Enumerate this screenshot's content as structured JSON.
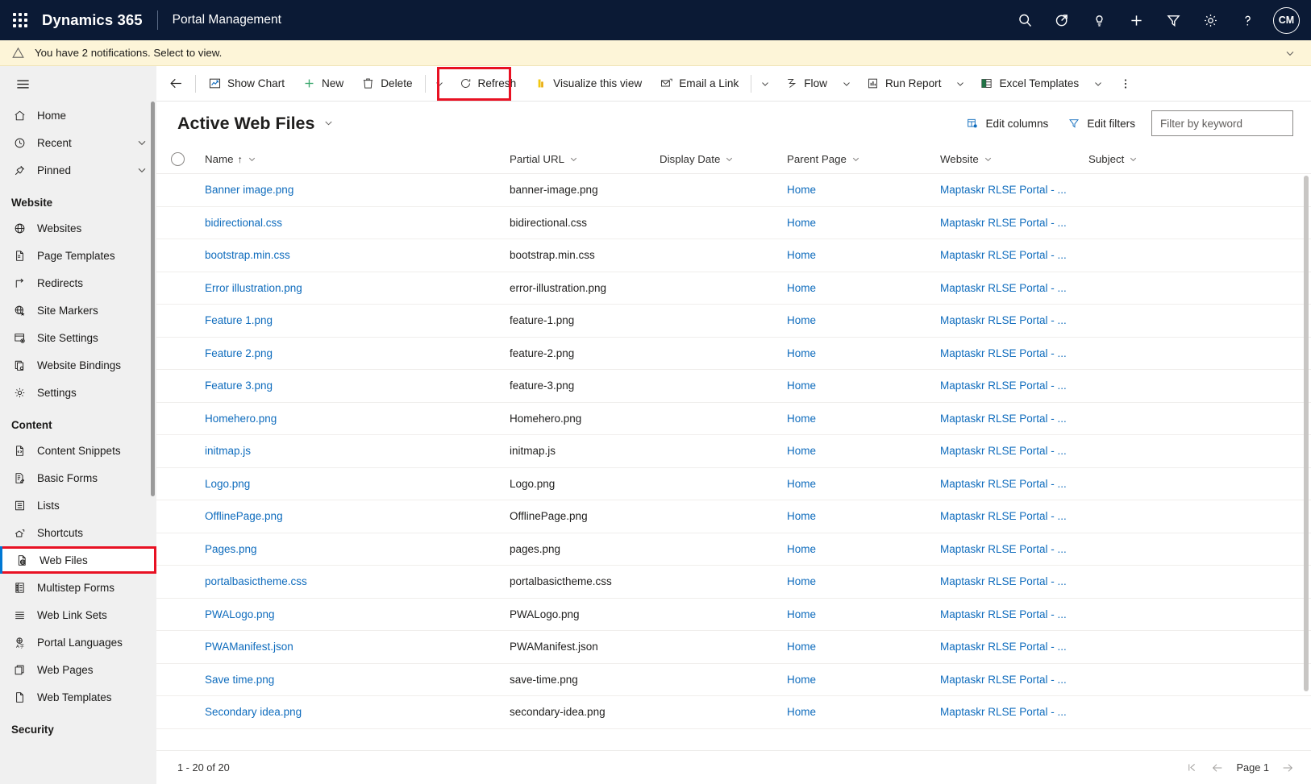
{
  "topbar": {
    "waffle_label": "App launcher",
    "brand": "Dynamics 365",
    "app_name": "Portal Management",
    "icons": [
      {
        "name": "search-icon",
        "label": "Search"
      },
      {
        "name": "diagnostics-icon",
        "label": "Diagnostics"
      },
      {
        "name": "lightbulb-icon",
        "label": "Tips"
      },
      {
        "name": "quick-create-icon",
        "label": "Quick create"
      },
      {
        "name": "filter-icon",
        "label": "Filter"
      },
      {
        "name": "gear-icon",
        "label": "Settings"
      },
      {
        "name": "help-icon",
        "label": "Help"
      }
    ],
    "avatar_initials": "CM"
  },
  "notification": {
    "text": "You have 2 notifications. Select to view.",
    "icon": "warning-icon",
    "collapse_icon": "chevron-down-icon",
    "bg_color": "#fdf5d8"
  },
  "sidebar": {
    "hamburger_label": "Expand/collapse navigation",
    "items": [
      {
        "label": "Home",
        "icon": "home-icon",
        "type": "item",
        "chevron": false
      },
      {
        "label": "Recent",
        "icon": "clock-icon",
        "type": "item",
        "chevron": true
      },
      {
        "label": "Pinned",
        "icon": "pin-icon",
        "type": "item",
        "chevron": true
      },
      {
        "label": "Website",
        "icon": "",
        "type": "group",
        "chevron": false
      },
      {
        "label": "Websites",
        "icon": "globe-icon",
        "type": "item",
        "chevron": false
      },
      {
        "label": "Page Templates",
        "icon": "page-template-icon",
        "type": "item",
        "chevron": false
      },
      {
        "label": "Redirects",
        "icon": "redirect-icon",
        "type": "item",
        "chevron": false
      },
      {
        "label": "Site Markers",
        "icon": "site-marker-icon",
        "type": "item",
        "chevron": false
      },
      {
        "label": "Site Settings",
        "icon": "site-settings-icon",
        "type": "item",
        "chevron": false
      },
      {
        "label": "Website Bindings",
        "icon": "website-binding-icon",
        "type": "item",
        "chevron": false
      },
      {
        "label": "Settings",
        "icon": "gear-icon",
        "type": "item",
        "chevron": false
      },
      {
        "label": "Content",
        "icon": "",
        "type": "group",
        "chevron": false
      },
      {
        "label": "Content Snippets",
        "icon": "code-snippet-icon",
        "type": "item",
        "chevron": false
      },
      {
        "label": "Basic Forms",
        "icon": "basic-form-icon",
        "type": "item",
        "chevron": false
      },
      {
        "label": "Lists",
        "icon": "list-icon",
        "type": "item",
        "chevron": false
      },
      {
        "label": "Shortcuts",
        "icon": "shortcut-icon",
        "type": "item",
        "chevron": false
      },
      {
        "label": "Web Files",
        "icon": "web-file-icon",
        "type": "item",
        "chevron": false,
        "selected": true
      },
      {
        "label": "Multistep Forms",
        "icon": "multistep-form-icon",
        "type": "item",
        "chevron": false
      },
      {
        "label": "Web Link Sets",
        "icon": "web-link-set-icon",
        "type": "item",
        "chevron": false
      },
      {
        "label": "Portal Languages",
        "icon": "language-icon",
        "type": "item",
        "chevron": false
      },
      {
        "label": "Web Pages",
        "icon": "web-page-icon",
        "type": "item",
        "chevron": false
      },
      {
        "label": "Web Templates",
        "icon": "web-template-icon",
        "type": "item",
        "chevron": false
      },
      {
        "label": "Security",
        "icon": "",
        "type": "group",
        "chevron": false
      }
    ],
    "selection_highlight_color": "#e81123"
  },
  "commandbar": {
    "back_label": "Back",
    "buttons": [
      {
        "label": "Show Chart",
        "icon": "chart-icon",
        "caret": false
      },
      {
        "label": "New",
        "icon": "plus-icon",
        "caret": false,
        "highlighted": true
      },
      {
        "label": "Delete",
        "icon": "trash-icon",
        "caret": true
      },
      {
        "label": "Refresh",
        "icon": "refresh-icon",
        "caret": false
      },
      {
        "label": "Visualize this view",
        "icon": "visualize-icon",
        "caret": false
      },
      {
        "label": "Email a Link",
        "icon": "email-icon",
        "caret": true
      },
      {
        "label": "Flow",
        "icon": "flow-icon",
        "caret": true
      },
      {
        "label": "Run Report",
        "icon": "report-icon",
        "caret": true
      },
      {
        "label": "Excel Templates",
        "icon": "excel-icon",
        "caret": true
      }
    ],
    "overflow_label": "More commands",
    "highlight_color": "#e81123"
  },
  "view": {
    "title": "Active Web Files",
    "title_caret_icon": "chevron-down-icon",
    "edit_columns_label": "Edit columns",
    "edit_filters_label": "Edit filters",
    "search_placeholder": "Filter by keyword",
    "search_value": ""
  },
  "grid": {
    "select_all_label": "Select all rows",
    "columns": [
      {
        "key": "name",
        "label": "Name",
        "sorted": "asc"
      },
      {
        "key": "url",
        "label": "Partial URL",
        "sorted": ""
      },
      {
        "key": "date",
        "label": "Display Date",
        "sorted": ""
      },
      {
        "key": "parent",
        "label": "Parent Page",
        "sorted": ""
      },
      {
        "key": "site",
        "label": "Website",
        "sorted": ""
      },
      {
        "key": "subject",
        "label": "Subject",
        "sorted": ""
      }
    ],
    "rows": [
      {
        "name": "Banner image.png",
        "url": "banner-image.png",
        "date": "",
        "parent": "Home",
        "site": "Maptaskr RLSE Portal - ...",
        "subject": ""
      },
      {
        "name": "bidirectional.css",
        "url": "bidirectional.css",
        "date": "",
        "parent": "Home",
        "site": "Maptaskr RLSE Portal - ...",
        "subject": ""
      },
      {
        "name": "bootstrap.min.css",
        "url": "bootstrap.min.css",
        "date": "",
        "parent": "Home",
        "site": "Maptaskr RLSE Portal - ...",
        "subject": ""
      },
      {
        "name": "Error illustration.png",
        "url": "error-illustration.png",
        "date": "",
        "parent": "Home",
        "site": "Maptaskr RLSE Portal - ...",
        "subject": ""
      },
      {
        "name": "Feature 1.png",
        "url": "feature-1.png",
        "date": "",
        "parent": "Home",
        "site": "Maptaskr RLSE Portal - ...",
        "subject": ""
      },
      {
        "name": "Feature 2.png",
        "url": "feature-2.png",
        "date": "",
        "parent": "Home",
        "site": "Maptaskr RLSE Portal - ...",
        "subject": ""
      },
      {
        "name": "Feature 3.png",
        "url": "feature-3.png",
        "date": "",
        "parent": "Home",
        "site": "Maptaskr RLSE Portal - ...",
        "subject": ""
      },
      {
        "name": "Homehero.png",
        "url": "Homehero.png",
        "date": "",
        "parent": "Home",
        "site": "Maptaskr RLSE Portal - ...",
        "subject": ""
      },
      {
        "name": "initmap.js",
        "url": "initmap.js",
        "date": "",
        "parent": "Home",
        "site": "Maptaskr RLSE Portal - ...",
        "subject": ""
      },
      {
        "name": "Logo.png",
        "url": "Logo.png",
        "date": "",
        "parent": "Home",
        "site": "Maptaskr RLSE Portal - ...",
        "subject": ""
      },
      {
        "name": "OfflinePage.png",
        "url": "OfflinePage.png",
        "date": "",
        "parent": "Home",
        "site": "Maptaskr RLSE Portal - ...",
        "subject": ""
      },
      {
        "name": "Pages.png",
        "url": "pages.png",
        "date": "",
        "parent": "Home",
        "site": "Maptaskr RLSE Portal - ...",
        "subject": ""
      },
      {
        "name": "portalbasictheme.css",
        "url": "portalbasictheme.css",
        "date": "",
        "parent": "Home",
        "site": "Maptaskr RLSE Portal - ...",
        "subject": ""
      },
      {
        "name": "PWALogo.png",
        "url": "PWALogo.png",
        "date": "",
        "parent": "Home",
        "site": "Maptaskr RLSE Portal - ...",
        "subject": ""
      },
      {
        "name": "PWAManifest.json",
        "url": "PWAManifest.json",
        "date": "",
        "parent": "Home",
        "site": "Maptaskr RLSE Portal - ...",
        "subject": ""
      },
      {
        "name": "Save time.png",
        "url": "save-time.png",
        "date": "",
        "parent": "Home",
        "site": "Maptaskr RLSE Portal - ...",
        "subject": ""
      },
      {
        "name": "Secondary idea.png",
        "url": "secondary-idea.png",
        "date": "",
        "parent": "Home",
        "site": "Maptaskr RLSE Portal - ...",
        "subject": ""
      }
    ]
  },
  "footer": {
    "count_text": "1 - 20 of 20",
    "first_page_label": "First page",
    "prev_page_label": "Previous page",
    "next_page_label": "Next page",
    "page_label": "Page 1"
  }
}
